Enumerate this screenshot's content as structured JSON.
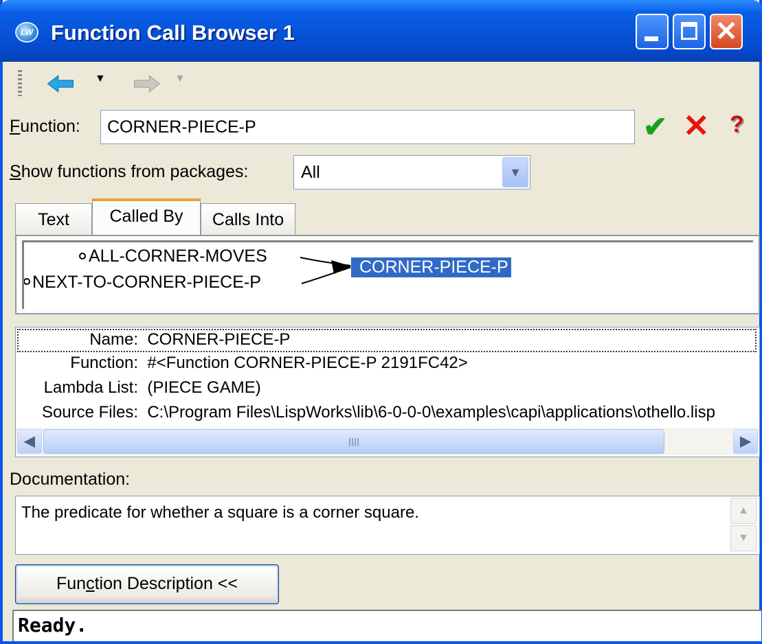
{
  "window": {
    "title": "Function Call Browser 1",
    "app_icon_text": "LW"
  },
  "toolbar": {
    "back_icon": "arrow-left-icon",
    "forward_icon": "arrow-right-icon"
  },
  "function_field": {
    "label_accel": "F",
    "label_rest": "unction:",
    "value": "CORNER-PIECE-P"
  },
  "packages": {
    "label_accel": "S",
    "label_rest": "how functions from packages:",
    "selected": "All"
  },
  "tabs": [
    {
      "label": "Text",
      "active": false
    },
    {
      "label": "Called By",
      "active": true
    },
    {
      "label": "Calls Into",
      "active": false
    }
  ],
  "graph": {
    "callers": [
      "ALL-CORNER-MOVES",
      "NEXT-TO-CORNER-PIECE-P"
    ],
    "target": "CORNER-PIECE-P"
  },
  "details": {
    "rows": [
      {
        "key": "Name:",
        "value": "CORNER-PIECE-P"
      },
      {
        "key": "Function:",
        "value": "#<Function CORNER-PIECE-P 2191FC42>"
      },
      {
        "key": "Lambda List:",
        "value": "(PIECE GAME)"
      },
      {
        "key": "Source Files:",
        "value": "C:\\Program Files\\LispWorks\\lib\\6-0-0-0\\examples\\capi\\applications\\othello.lisp"
      }
    ]
  },
  "documentation": {
    "label": "Documentation:",
    "text": "The predicate for whether a square is a corner square."
  },
  "description_button": {
    "pre": "Fun",
    "accel": "c",
    "post": "tion Description <<"
  },
  "status": {
    "text": "Ready."
  },
  "colors": {
    "selection": "#316ac5",
    "titlebar": "#0752d8",
    "confirm": "#17a21c",
    "cancel": "#e8140c"
  }
}
